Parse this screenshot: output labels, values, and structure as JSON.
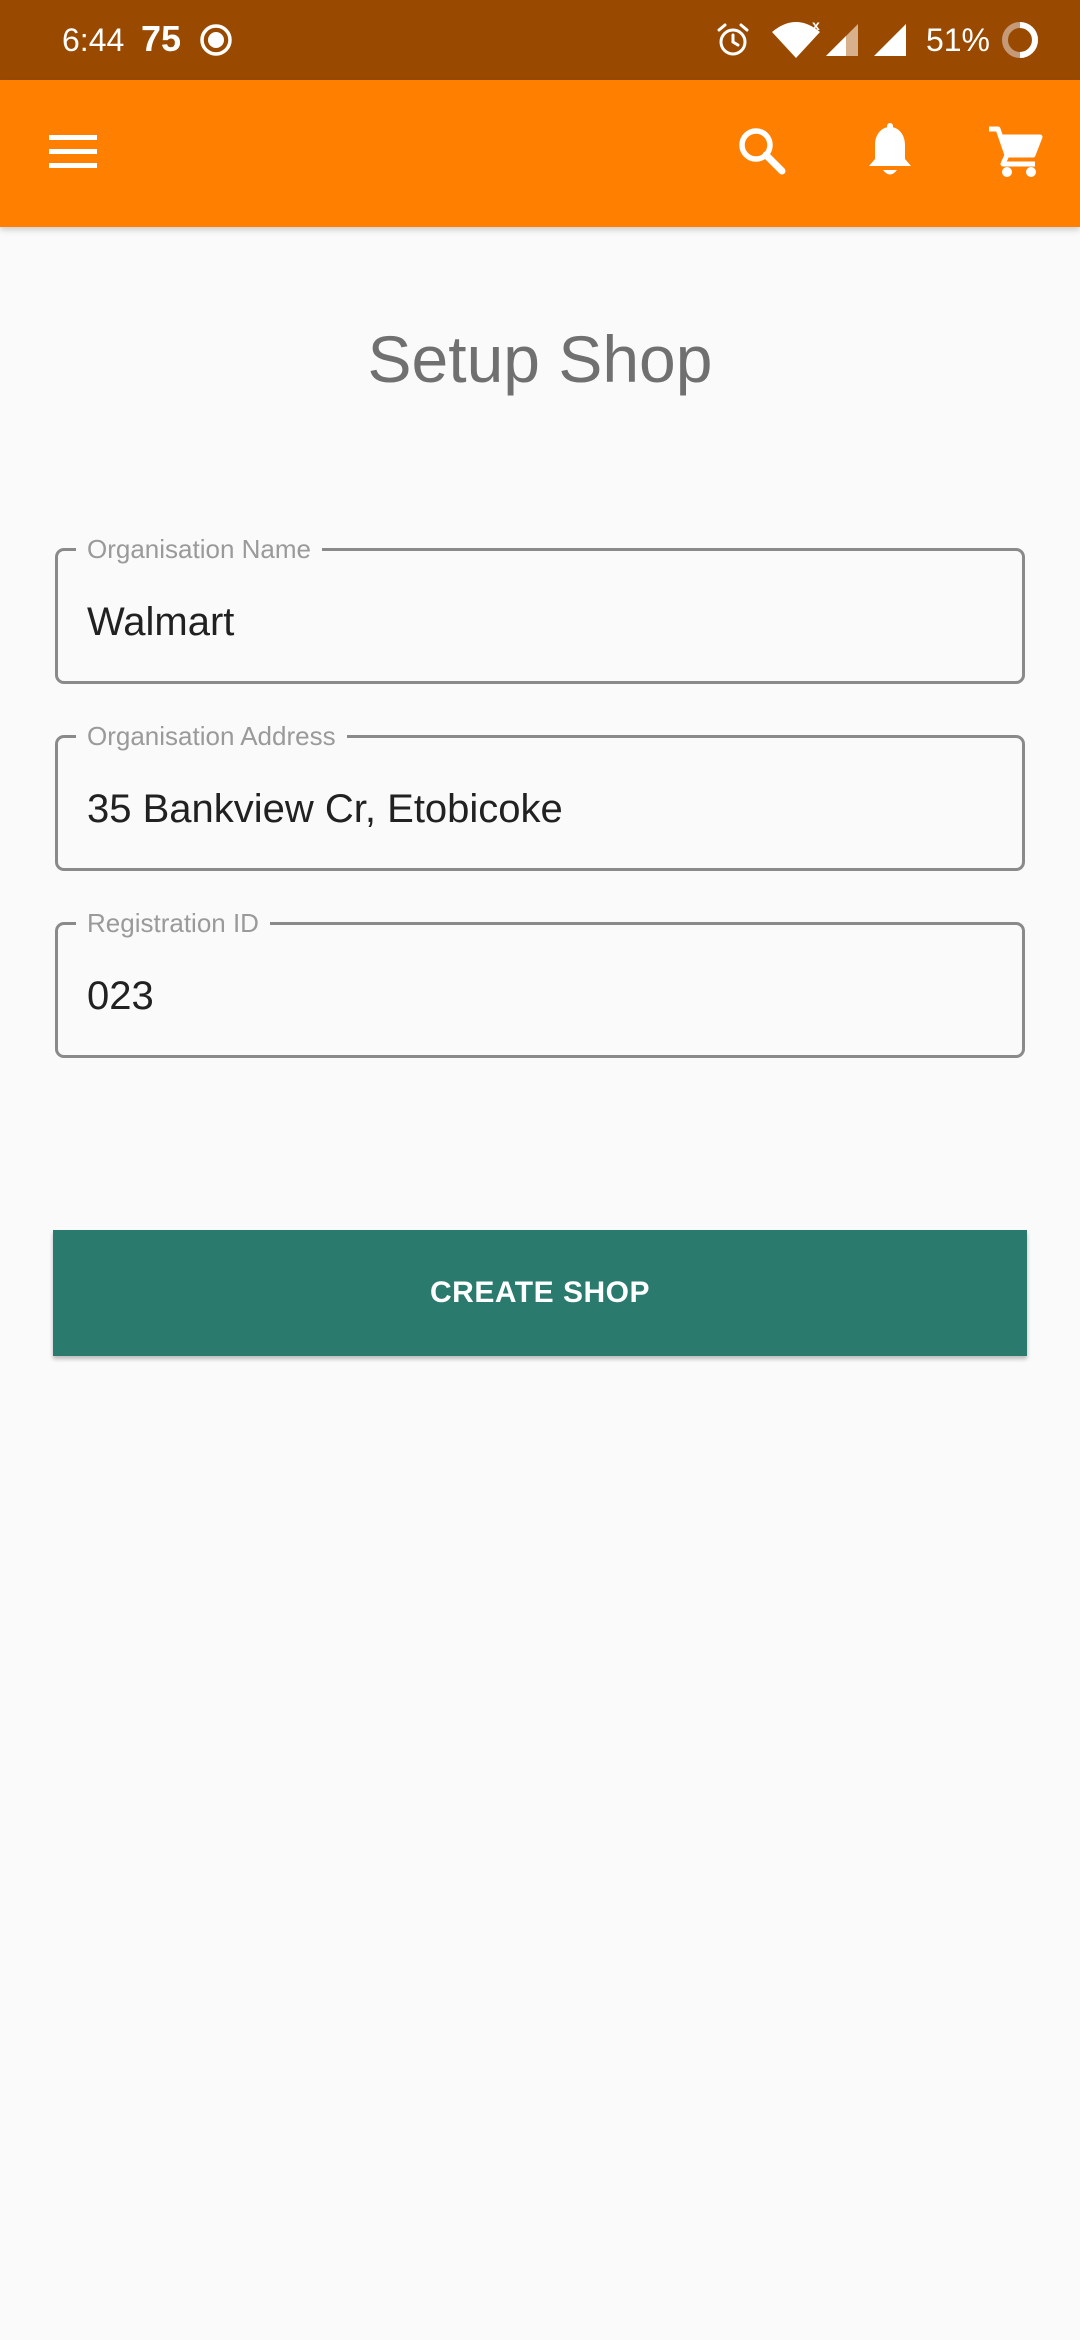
{
  "status_bar": {
    "time": "6:44",
    "indicator_number": "75",
    "battery_percent": "51%",
    "icons": [
      "record-ring-icon",
      "alarm-icon",
      "wifi-icon",
      "signal-icon",
      "signal-icon",
      "battery-ring-icon"
    ]
  },
  "app_bar": {
    "background_color": "#ff7f00",
    "icons": [
      "menu-icon",
      "search-icon",
      "bell-icon",
      "cart-icon"
    ]
  },
  "page": {
    "title": "Setup Shop"
  },
  "form": {
    "fields": [
      {
        "label": "Organisation Name",
        "value": "Walmart"
      },
      {
        "label": "Organisation Address",
        "value": "35 Bankview Cr, Etobicoke"
      },
      {
        "label": "Registration ID",
        "value": "023"
      }
    ],
    "submit_label": "CREATE SHOP",
    "submit_color": "#2a7a6e"
  }
}
